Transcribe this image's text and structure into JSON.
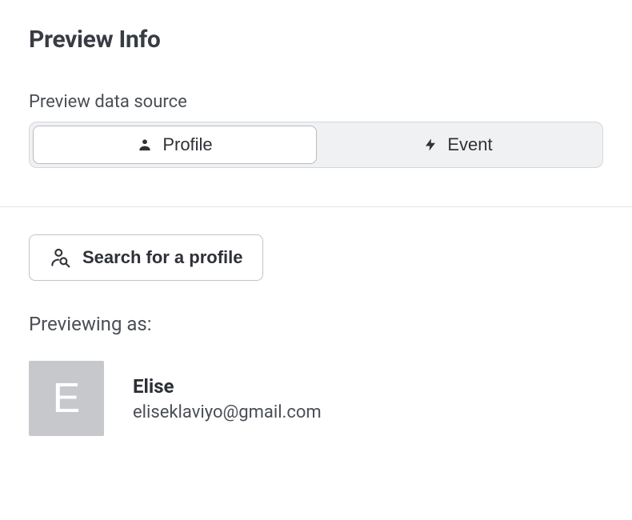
{
  "header": {
    "title": "Preview Info"
  },
  "dataSource": {
    "label": "Preview data source",
    "options": [
      {
        "label": "Profile",
        "icon": "person-icon",
        "active": true
      },
      {
        "label": "Event",
        "icon": "bolt-icon",
        "active": false
      }
    ]
  },
  "search": {
    "button_label": "Search for a profile"
  },
  "previewing": {
    "label": "Previewing as:",
    "profile": {
      "avatar_initial": "E",
      "name": "Elise",
      "email": "eliseklaviyo@gmail.com"
    }
  }
}
